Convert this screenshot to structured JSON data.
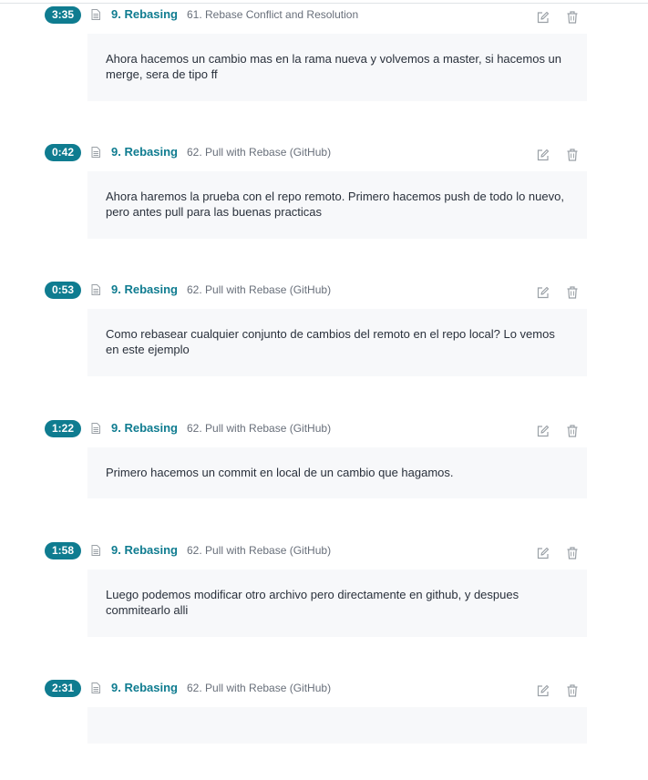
{
  "notes": [
    {
      "time": "3:35",
      "section": "9. Rebasing",
      "lecture": "61. Rebase Conflict and Resolution",
      "text": "Ahora hacemos un cambio mas en la rama nueva y volvemos a master, si hacemos un merge, sera de tipo ff"
    },
    {
      "time": "0:42",
      "section": "9. Rebasing",
      "lecture": "62. Pull with Rebase (GitHub)",
      "text": "Ahora haremos la prueba con el repo remoto. Primero hacemos push de todo lo nuevo, pero antes pull para las buenas practicas"
    },
    {
      "time": "0:53",
      "section": "9. Rebasing",
      "lecture": "62. Pull with Rebase (GitHub)",
      "text": "Como rebasear cualquier conjunto de cambios del remoto en el repo local? Lo vemos en este ejemplo"
    },
    {
      "time": "1:22",
      "section": "9. Rebasing",
      "lecture": "62. Pull with Rebase (GitHub)",
      "text": "Primero hacemos un commit en local de un cambio que hagamos."
    },
    {
      "time": "1:58",
      "section": "9. Rebasing",
      "lecture": "62. Pull with Rebase (GitHub)",
      "text": "Luego podemos modificar otro archivo pero directamente en github, y despues commitearlo alli"
    },
    {
      "time": "2:31",
      "section": "9. Rebasing",
      "lecture": "62. Pull with Rebase (GitHub)",
      "text": ""
    }
  ],
  "icons": {
    "lecture": "document-icon",
    "edit": "edit-icon",
    "delete": "trash-icon"
  },
  "colors": {
    "accent": "#0f7c90",
    "note_background": "#f7f8fa",
    "muted_text": "#686f7a",
    "icon_gray": "#9aa0a6"
  }
}
